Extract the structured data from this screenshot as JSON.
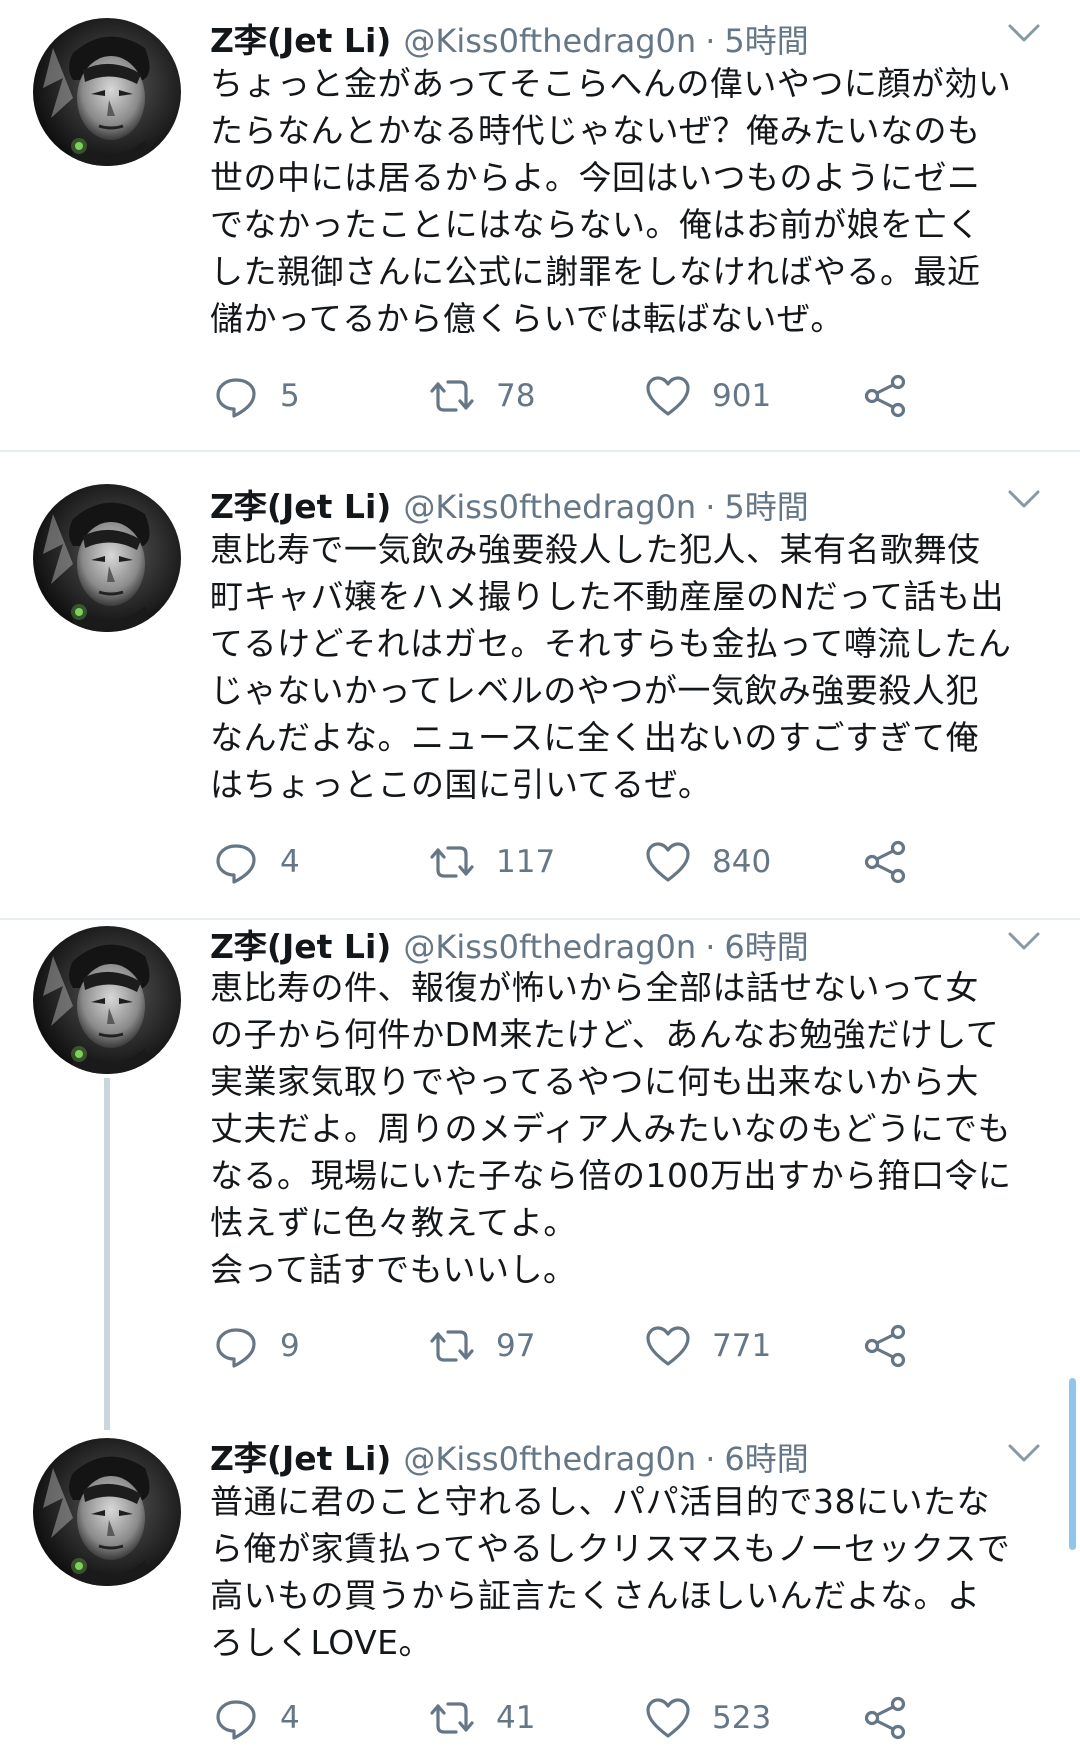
{
  "tweets": [
    {
      "name": "Z李(Jet Li)",
      "handle": "@Kiss0fthedrag0n",
      "dot": "·",
      "time": "5時間",
      "lines": [
        "ちょっと金があってそこらへんの偉いやつに顔が効い",
        "たらなんとかなる時代じゃないぜ？俺みたいなのも",
        "世の中には居るからよ。今回はいつものようにゼニ",
        "でなかったことにはならない。俺はお前が娘を亡く",
        "した親御さんに公式に謝罪をしなければやる。最近",
        "儲かってるから億くらいでは転ばないぜ。"
      ],
      "replies": "5",
      "retweets": "78",
      "likes": "901"
    },
    {
      "name": "Z李(Jet Li)",
      "handle": "@Kiss0fthedrag0n",
      "dot": "·",
      "time": "5時間",
      "lines": [
        "恵比寿で一気飲み強要殺人した犯人、某有名歌舞伎",
        "町キャバ嬢をハメ撮りした不動産屋のNだって話も出",
        "てるけどそれはガセ。それすらも金払って噂流したん",
        "じゃないかってレベルのやつが一気飲み強要殺人犯",
        "なんだよな。ニュースに全く出ないのすごすぎて俺",
        "はちょっとこの国に引いてるぜ。"
      ],
      "replies": "4",
      "retweets": "117",
      "likes": "840"
    },
    {
      "name": "Z李(Jet Li)",
      "handle": "@Kiss0fthedrag0n",
      "dot": "·",
      "time": "6時間",
      "lines": [
        "恵比寿の件、報復が怖いから全部は話せないって女",
        "の子から何件かDM来たけど、あんなお勉強だけして",
        "実業家気取りでやってるやつに何も出来ないから大",
        "丈夫だよ。周りのメディア人みたいなのもどうにでも",
        "なる。現場にいた子なら倍の100万出すから箝口令に",
        "怯えずに色々教えてよ。",
        "会って話すでもいいし。"
      ],
      "replies": "9",
      "retweets": "97",
      "likes": "771"
    },
    {
      "name": "Z李(Jet Li)",
      "handle": "@Kiss0fthedrag0n",
      "dot": "·",
      "time": "6時間",
      "lines": [
        "普通に君のこと守れるし、パパ活目的で38にいたな",
        "ら俺が家賃払ってやるしクリスマスもノーセックスで",
        "高いもの買うから証言たくさんほしいんだよな。よ",
        "ろしくLOVE。"
      ],
      "replies": "4",
      "retweets": "41",
      "likes": "523"
    }
  ],
  "icons": {
    "reply": "speech-bubble-icon",
    "retweet": "retweet-arrows-icon",
    "like": "heart-outline-icon",
    "share": "share-nodes-icon",
    "caret": "chevron-down-icon"
  },
  "colors": {
    "text": "#14171a",
    "secondary": "#657786",
    "divider": "#e6ecf0",
    "thread_line": "#ccd6dd",
    "scrollbar": "#8fc6ee"
  }
}
